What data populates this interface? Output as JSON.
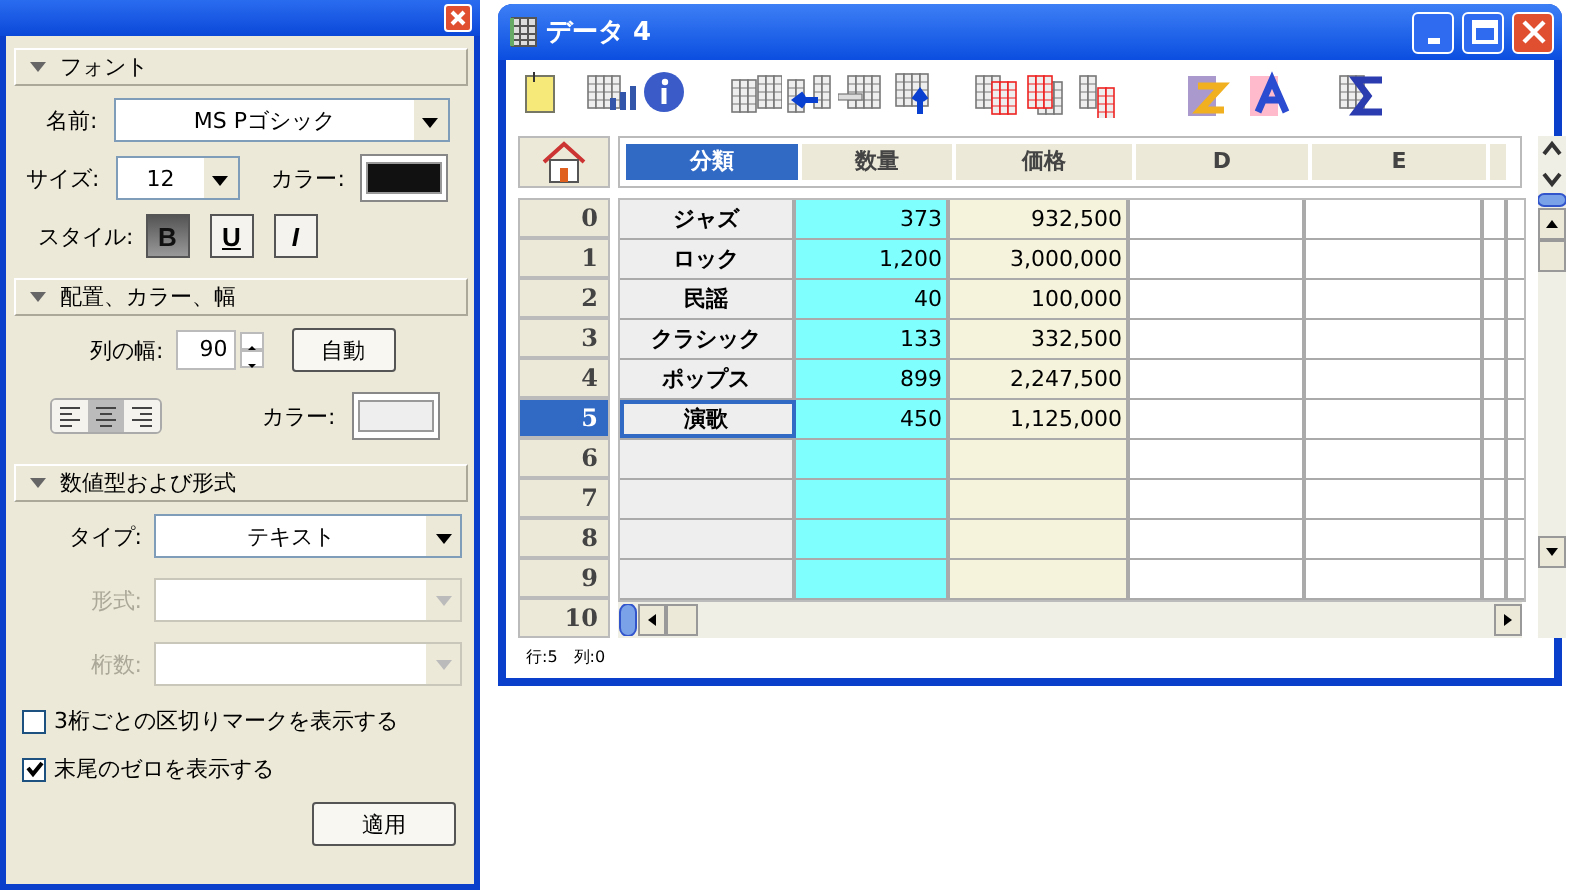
{
  "inspector": {
    "sections": [
      {
        "title": "フォント",
        "expanded": true
      },
      {
        "title": "配置、カラー、幅",
        "expanded": true
      },
      {
        "title": "数値型および形式",
        "expanded": true
      }
    ],
    "font": {
      "name_label": "名前:",
      "name_value": "MS Pゴシック",
      "size_label": "サイズ:",
      "size_value": "12",
      "color_label": "カラー:",
      "color": "#111111",
      "style_label": "スタイル:",
      "style_buttons": [
        {
          "label": "B",
          "kind": "bold",
          "selected": true
        },
        {
          "label": "U",
          "kind": "underline",
          "selected": false
        },
        {
          "label": "I",
          "kind": "italic",
          "selected": false
        }
      ]
    },
    "layout": {
      "width_label": "列の幅:",
      "width_value": "90",
      "auto_button": "自動",
      "alignments": [
        {
          "kind": "left",
          "selected": false
        },
        {
          "kind": "center",
          "selected": true
        },
        {
          "kind": "right",
          "selected": false
        }
      ],
      "color_label": "カラー:",
      "color": "#eeeeee"
    },
    "number": {
      "fields": [
        {
          "label": "タイプ:",
          "value": "テキスト",
          "disabled": false
        },
        {
          "label": "形式:",
          "disabled": true
        },
        {
          "label": "桁数:",
          "disabled": true
        }
      ],
      "checkboxes": [
        {
          "label": "3桁ごとの区切りマークを表示する",
          "checked": false
        },
        {
          "label": "末尾のゼロを表示する",
          "checked": true
        }
      ],
      "apply_button": "適用"
    }
  },
  "window": {
    "title": "データ 4"
  },
  "table": {
    "columns": [
      {
        "label": "分類",
        "selected": true,
        "color": "#eeeeee"
      },
      {
        "label": "数量",
        "selected": false,
        "color": "#80ffff"
      },
      {
        "label": "価格",
        "selected": false,
        "color": "#f5f3dc"
      },
      {
        "label": "D",
        "selected": false,
        "color": "#ffffff"
      },
      {
        "label": "E",
        "selected": false,
        "color": "#ffffff"
      }
    ],
    "row_headers": [
      {
        "label": "0",
        "selected": false
      },
      {
        "label": "1",
        "selected": false
      },
      {
        "label": "2",
        "selected": false
      },
      {
        "label": "3",
        "selected": false
      },
      {
        "label": "4",
        "selected": false
      },
      {
        "label": "5",
        "selected": true
      },
      {
        "label": "6",
        "selected": false
      },
      {
        "label": "7",
        "selected": false
      },
      {
        "label": "8",
        "selected": false
      },
      {
        "label": "9",
        "selected": false
      },
      {
        "label": "10",
        "selected": false,
        "cut": true
      }
    ],
    "rows": [
      [
        "ジャズ",
        "373",
        "932,500"
      ],
      [
        "ロック",
        "1,200",
        "3,000,000"
      ],
      [
        "民謡",
        "40",
        "100,000"
      ],
      [
        "クラシック",
        "133",
        "332,500"
      ],
      [
        "ポップス",
        "899",
        "2,247,500"
      ],
      [
        "演歌",
        "450",
        "1,125,000"
      ]
    ]
  },
  "status_bar": {
    "row": "行:5",
    "column": "列:0"
  }
}
